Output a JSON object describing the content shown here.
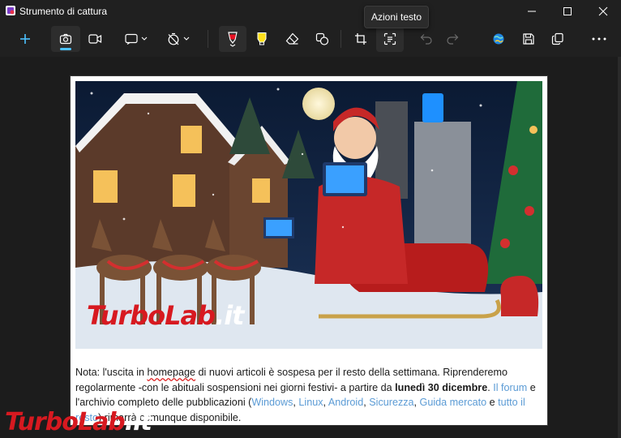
{
  "window": {
    "title": "Strumento di cattura",
    "tooltip": "Azioni testo",
    "controls": [
      "minimize",
      "maximize",
      "close"
    ]
  },
  "toolbar": {
    "buttons": [
      {
        "name": "new-capture",
        "icon": "plus-icon"
      },
      {
        "name": "screenshot-mode",
        "icon": "camera-icon",
        "selected": true
      },
      {
        "name": "video-mode",
        "icon": "video-icon"
      },
      {
        "name": "capture-shape",
        "icon": "rectangle-select-icon",
        "dropdown": true
      },
      {
        "name": "delay",
        "icon": "timer-off-icon",
        "dropdown": true
      },
      {
        "name": "ballpoint-pen",
        "icon": "pen-icon",
        "color": "#e81123",
        "active": true
      },
      {
        "name": "highlighter",
        "icon": "highlighter-icon",
        "color": "#ffe01b"
      },
      {
        "name": "eraser",
        "icon": "eraser-icon"
      },
      {
        "name": "shapes",
        "icon": "shapes-icon"
      },
      {
        "name": "crop",
        "icon": "crop-icon"
      },
      {
        "name": "text-actions",
        "icon": "text-actions-icon",
        "active": true
      },
      {
        "name": "undo",
        "icon": "undo-icon",
        "disabled": true
      },
      {
        "name": "redo",
        "icon": "redo-icon",
        "disabled": true
      },
      {
        "name": "edit-in-paint",
        "icon": "paint-globe-icon"
      },
      {
        "name": "save",
        "icon": "save-icon"
      },
      {
        "name": "copy",
        "icon": "copy-icon"
      },
      {
        "name": "more",
        "icon": "more-icon"
      }
    ],
    "accent": "#4cc2ff"
  },
  "capture": {
    "image_watermark": {
      "left": "TurboLab",
      "right": ".it"
    },
    "note": {
      "t1": "Nota: l'uscita in ",
      "t2": "homepage",
      "t3": " di nuovi articoli è sospesa per il resto della settimana. Riprenderemo regolarmente -con le abituali sospensioni nei giorni festivi- a partire da ",
      "date": "lunedì 30 dicembre",
      "t4": ". ",
      "forum": "Il forum",
      "t5": " e l'archivio completo delle pubblicazioni (",
      "l1": "Windows",
      "l2": "Linux",
      "l3": "Android",
      "l4": "Sicurezza",
      "l5": "Guida mercato",
      "t6": " e ",
      "l6": "tutto il resto",
      "t7": ") rimarrà comunque disponibile."
    }
  },
  "watermark": {
    "left": "TurboLab",
    "right": ".it"
  },
  "colors": {
    "background": "#202020",
    "canvas": "#1c1c1c",
    "link": "#5b9bd5",
    "brand_red": "#d71920"
  }
}
